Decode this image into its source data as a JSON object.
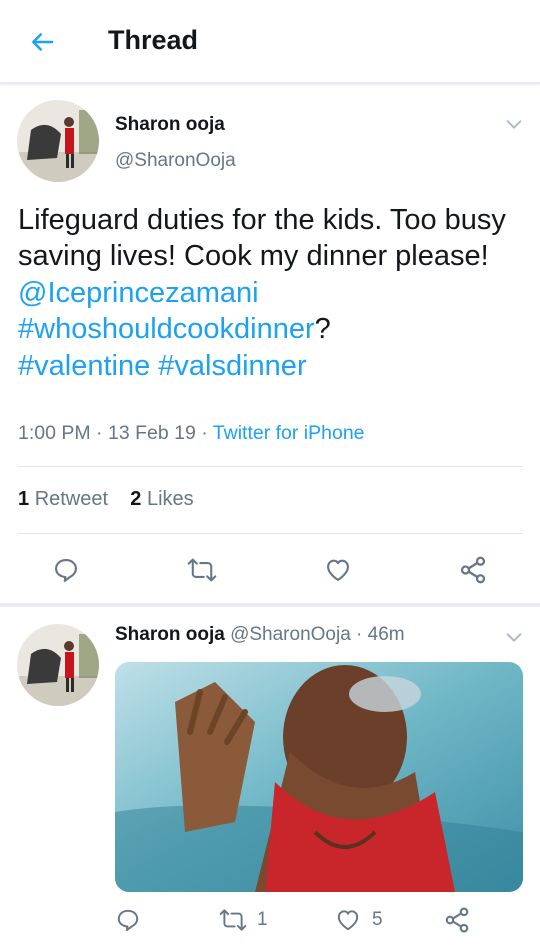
{
  "header": {
    "title": "Thread",
    "back_icon": "arrow-left-icon"
  },
  "colors": {
    "accent": "#1da1f2",
    "muted": "#657786",
    "text": "#14171a",
    "divider": "#e1e8ed"
  },
  "main_tweet": {
    "author_name": "Sharon ooja",
    "author_handle": "@SharonOoja",
    "text_plain_1": "Lifeguard duties for the kids. Too busy saving lives! Cook my dinner please! ",
    "mention": "@Iceprincezamani",
    "hashtag_1": "#whoshouldcookdinner",
    "text_plain_2": "? ",
    "hashtag_2": "#valentine",
    "hashtag_3": "#valsdinner",
    "time": "1:00 PM",
    "date": "13 Feb 19",
    "source": "Twitter for iPhone",
    "retweets_count": "1",
    "retweets_label": "Retweet",
    "likes_count": "2",
    "likes_label": "Likes"
  },
  "reply_tweet": {
    "author_name": "Sharon ooja",
    "author_handle": "@SharonOoja",
    "age": "46m",
    "retweet_count": "1",
    "like_count": "5"
  }
}
